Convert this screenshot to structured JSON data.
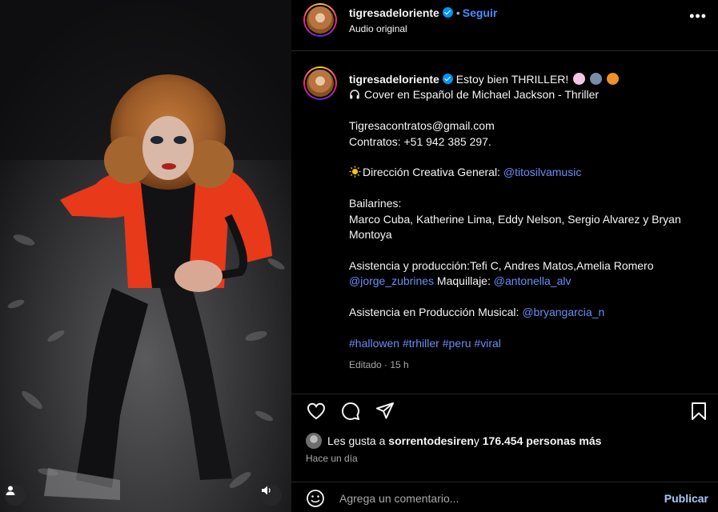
{
  "post_header": {
    "username": "tigresadeloriente",
    "separator": "•",
    "follow_label": "Seguir",
    "subtitle": "Audio original",
    "more_label": "•••"
  },
  "caption": {
    "username": "tigresadeloriente",
    "title": "Estoy bien THRILLER!",
    "audio_line": "Cover en Español de Michael Jackson - Thriller",
    "email": "Tigresacontratos@gmail.com",
    "contracts": "Contratos: +51 942 385 297.",
    "direction_prefix": "Dirección Creativa General: ",
    "direction_handle": "@titosilvamusic",
    "dancers_label": "Bailarines:",
    "dancers": "Marco Cuba, Katherine Lima, Eddy Nelson, Sergio Alvarez y Bryan Montoya",
    "assist_prefix": "Asistencia y producción:Tefi C, Andres Matos,Amelia Romero",
    "assist_handle": "@jorge_zubrines",
    "makeup_prefix": " Maquillaje: ",
    "makeup_handle": "@antonella_alv",
    "music_prefix": "Asistencia en Producción Musical: ",
    "music_handle": "@bryangarcia_n",
    "hashtags": "#hallowen #trhiller #peru #viral",
    "edited": "Editado · 15 h"
  },
  "engagement": {
    "likes_prefix": "Les gusta a ",
    "liked_by": "sorrentodesiren",
    "likes_middle": " y ",
    "likes_count": "176.454 personas más",
    "time_ago": "Hace un día"
  },
  "comment": {
    "placeholder": "Agrega un comentario...",
    "publish_label": "Publicar"
  },
  "icons": {
    "like": "heart-icon",
    "comment": "comment-icon",
    "share": "send-icon",
    "save": "bookmark-icon",
    "emoji": "emoji-icon",
    "verified": "verified-badge-icon",
    "audio": "headphones-icon",
    "sun": "sun-icon",
    "user": "user-tag-icon",
    "sound": "speaker-icon"
  },
  "colors": {
    "background": "#000000",
    "link": "#6b8df7",
    "follow": "#4a8cff",
    "verified": "#0095f6",
    "muted": "#a8a8a8",
    "jacket": "#e8391a"
  }
}
